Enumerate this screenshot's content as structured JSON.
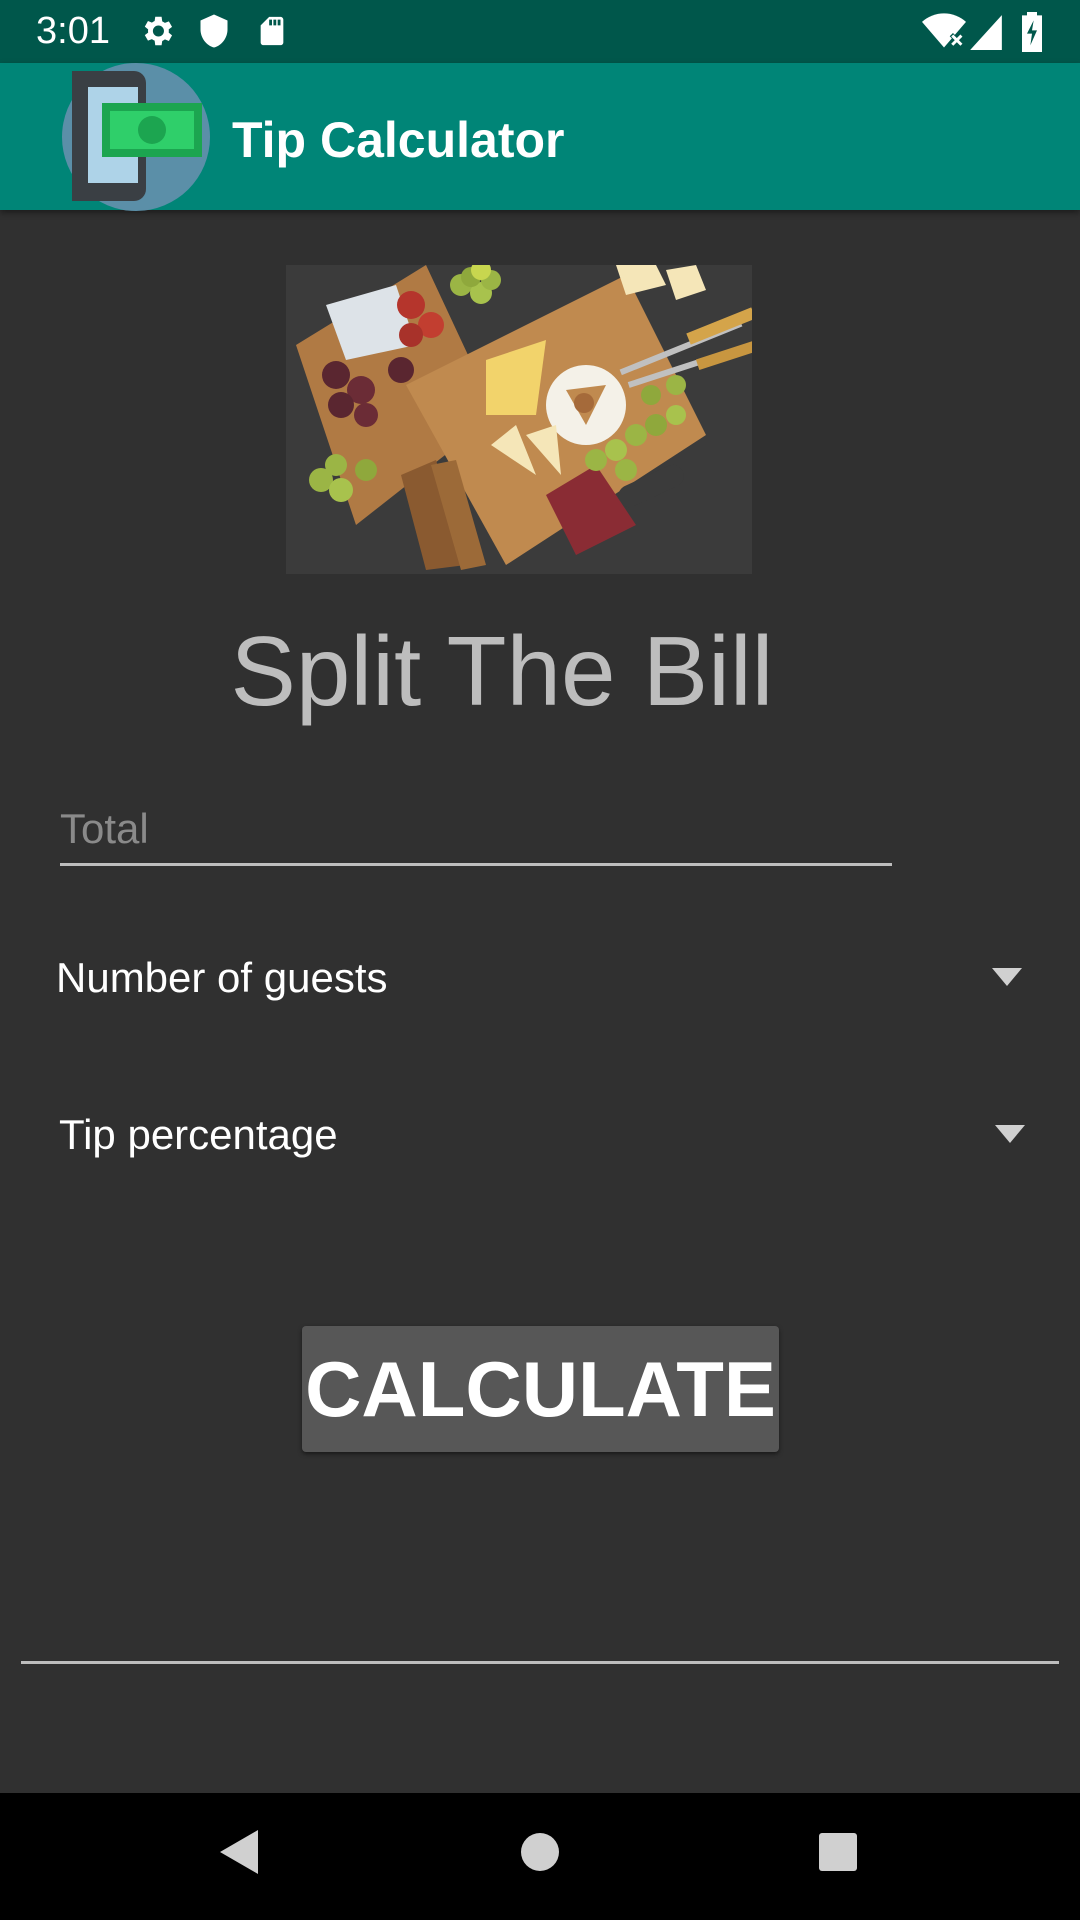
{
  "status_bar": {
    "time": "3:01",
    "left_icons": [
      "gear-icon",
      "shield-icon",
      "sd-card-icon"
    ],
    "right_icons": [
      "wifi-icon",
      "signal-icon",
      "battery-charging-icon"
    ]
  },
  "app_bar": {
    "title": "Tip Calculator",
    "logo": "phone-money-logo",
    "color": "#008577"
  },
  "hero": {
    "image": "charcuterie-board-photo",
    "headline": "Split The Bill"
  },
  "form": {
    "total_placeholder": "Total",
    "total_value": "",
    "guests_label": "Number of guests",
    "tip_label": "Tip percentage",
    "calculate_label": "CALCULATE"
  },
  "nav_bar": {
    "buttons": [
      "back-icon",
      "home-icon",
      "recents-icon"
    ]
  }
}
